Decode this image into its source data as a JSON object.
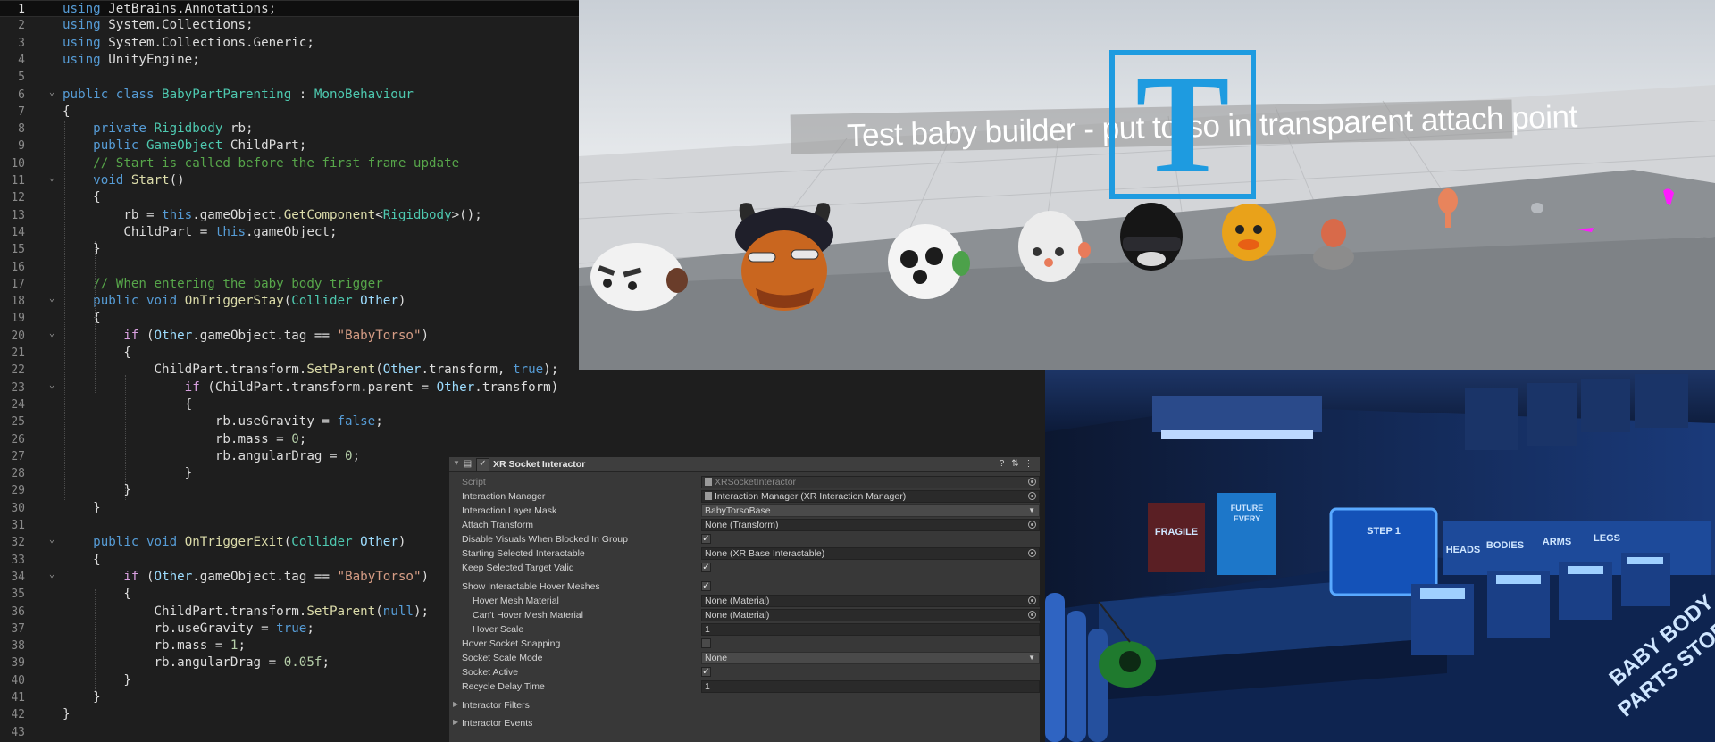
{
  "code_editor": {
    "lines": [
      {
        "n": "1",
        "html": "<span class=\"kw\">using</span> JetBrains.Annotations;"
      },
      {
        "n": "2",
        "html": "<span class=\"kw\">using</span> System.Collections;"
      },
      {
        "n": "3",
        "html": "<span class=\"kw\">using</span> System.Collections.Generic;"
      },
      {
        "n": "4",
        "html": "<span class=\"kw\">using</span> UnityEngine;"
      },
      {
        "n": "5",
        "html": ""
      },
      {
        "n": "6",
        "html": "<span class=\"kw\">public class</span> <span class=\"ty\">BabyPartParenting</span> : <span class=\"ty\">MonoBehaviour</span>"
      },
      {
        "n": "7",
        "html": "{"
      },
      {
        "n": "8",
        "html": "    <span class=\"kw\">private</span> <span class=\"ty\">Rigidbody</span> rb;"
      },
      {
        "n": "9",
        "html": "    <span class=\"kw\">public</span> <span class=\"ty\">GameObject</span> ChildPart;"
      },
      {
        "n": "10",
        "html": "    <span class=\"cm\">// Start is called before the first frame update</span>"
      },
      {
        "n": "11",
        "html": "    <span class=\"kw\">void</span> <span class=\"fn\">Start</span>()"
      },
      {
        "n": "12",
        "html": "    {"
      },
      {
        "n": "13",
        "html": "        rb = <span class=\"kw\">this</span>.gameObject.<span class=\"fn\">GetComponent</span>&lt;<span class=\"ty\">Rigidbody</span>&gt;();"
      },
      {
        "n": "14",
        "html": "        ChildPart = <span class=\"kw\">this</span>.gameObject;"
      },
      {
        "n": "15",
        "html": "    }"
      },
      {
        "n": "16",
        "html": ""
      },
      {
        "n": "17",
        "html": "    <span class=\"cm\">// When entering the baby body trigger</span>"
      },
      {
        "n": "18",
        "html": "    <span class=\"kw\">public void</span> <span class=\"fn\">OnTriggerStay</span>(<span class=\"ty\">Collider</span> <span class=\"pa\">Other</span>)"
      },
      {
        "n": "19",
        "html": "    {"
      },
      {
        "n": "20",
        "html": "        <span class=\"ctl\">if</span> (<span class=\"pa\">Other</span>.gameObject.tag == <span class=\"st\">\"BabyTorso\"</span>)"
      },
      {
        "n": "21",
        "html": "        {"
      },
      {
        "n": "22",
        "html": "            ChildPart.transform.<span class=\"fn\">SetParent</span>(<span class=\"pa\">Other</span>.transform, <span class=\"kw\">true</span>);"
      },
      {
        "n": "23",
        "html": "                <span class=\"ctl\">if</span> (ChildPart.transform.parent = <span class=\"pa\">Other</span>.transform)"
      },
      {
        "n": "24",
        "html": "                {"
      },
      {
        "n": "25",
        "html": "                    rb.useGravity = <span class=\"kw\">false</span>;"
      },
      {
        "n": "26",
        "html": "                    rb.mass = <span class=\"nu\">0</span>;"
      },
      {
        "n": "27",
        "html": "                    rb.angularDrag = <span class=\"nu\">0</span>;"
      },
      {
        "n": "28",
        "html": "                }"
      },
      {
        "n": "29",
        "html": "        }"
      },
      {
        "n": "30",
        "html": "    }"
      },
      {
        "n": "31",
        "html": ""
      },
      {
        "n": "32",
        "html": "    <span class=\"kw\">public void</span> <span class=\"fn\">OnTriggerExit</span>(<span class=\"ty\">Collider</span> <span class=\"pa\">Other</span>)"
      },
      {
        "n": "33",
        "html": "    {"
      },
      {
        "n": "34",
        "html": "        <span class=\"ctl\">if</span> (<span class=\"pa\">Other</span>.gameObject.tag == <span class=\"st\">\"BabyTorso\"</span>)"
      },
      {
        "n": "35",
        "html": "        {"
      },
      {
        "n": "36",
        "html": "            ChildPart.transform.<span class=\"fn\">SetParent</span>(<span class=\"kw\">null</span>);"
      },
      {
        "n": "37",
        "html": "            rb.useGravity = <span class=\"kw\">true</span>;"
      },
      {
        "n": "38",
        "html": "            rb.mass = <span class=\"nu\">1</span>;"
      },
      {
        "n": "39",
        "html": "            rb.angularDrag = <span class=\"nu\">0.05f</span>;"
      },
      {
        "n": "40",
        "html": "        }"
      },
      {
        "n": "41",
        "html": "    }"
      },
      {
        "n": "42",
        "html": "}"
      },
      {
        "n": "43",
        "html": ""
      }
    ]
  },
  "game_view": {
    "title_text": "Test baby builder - put torso in transparent attach point",
    "logo_letter": "T"
  },
  "lab_scene": {
    "poster_1": "FRAGILE",
    "poster_2_lines": [
      "FUTURE",
      "EVERY"
    ],
    "screen_title": "STEP 1",
    "bin_labels": [
      "HEADS",
      "BODIES",
      "ARMS",
      "LEGS"
    ],
    "floor_text_lines": [
      "BABY BODY",
      "PARTS STORAGE"
    ]
  },
  "inspector": {
    "component_title": "XR Socket Interactor",
    "rows": {
      "script": {
        "label": "Script",
        "value": "XRSocketInteractor"
      },
      "interaction_manager": {
        "label": "Interaction Manager",
        "value": "Interaction Manager (XR Interaction Manager)"
      },
      "interaction_layer_mask": {
        "label": "Interaction Layer Mask",
        "value": "BabyTorsoBase"
      },
      "attach_transform": {
        "label": "Attach Transform",
        "value": "None (Transform)"
      },
      "disable_visuals": {
        "label": "Disable Visuals When Blocked In Group",
        "checked": "✓"
      },
      "starting_selected": {
        "label": "Starting Selected Interactable",
        "value": "None (XR Base Interactable)"
      },
      "keep_selected": {
        "label": "Keep Selected Target Valid",
        "checked": "✓"
      },
      "show_hover_meshes": {
        "label": "Show Interactable Hover Meshes",
        "checked": "✓"
      },
      "hover_mesh_material": {
        "label": "Hover Mesh Material",
        "value": "None (Material)"
      },
      "cant_hover_mesh_material": {
        "label": "Can't Hover Mesh Material",
        "value": "None (Material)"
      },
      "hover_scale": {
        "label": "Hover Scale",
        "value": "1"
      },
      "hover_socket_snapping": {
        "label": "Hover Socket Snapping",
        "checked": ""
      },
      "socket_scale_mode": {
        "label": "Socket Scale Mode",
        "value": "None"
      },
      "socket_active": {
        "label": "Socket Active",
        "checked": "✓"
      },
      "recycle_delay_time": {
        "label": "Recycle Delay Time",
        "value": "1"
      },
      "interactor_filters": {
        "label": "Interactor Filters"
      },
      "interactor_events": {
        "label": "Interactor Events"
      }
    }
  }
}
